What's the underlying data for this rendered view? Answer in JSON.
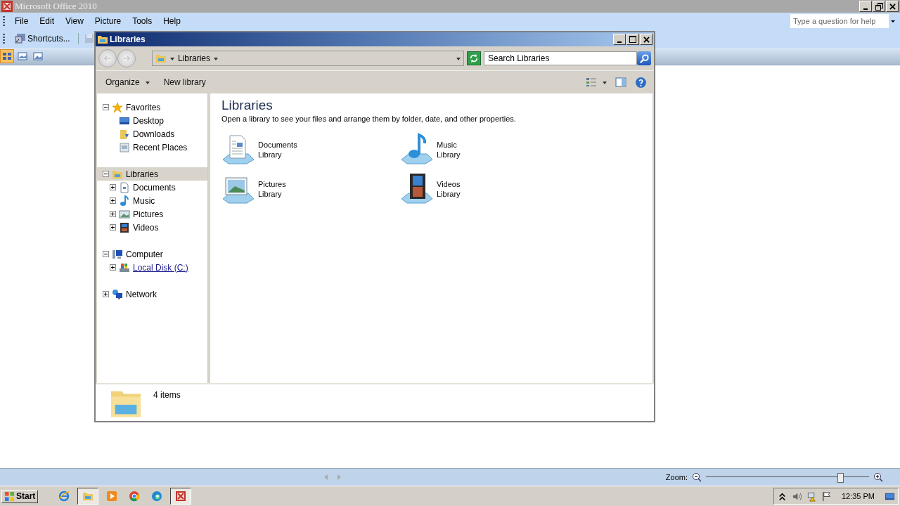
{
  "app": {
    "title": "Microsoft Office 2010",
    "menu": [
      "File",
      "Edit",
      "View",
      "Picture",
      "Tools",
      "Help"
    ],
    "help_box": {
      "placeholder": "Type a question for help"
    },
    "toolbar": {
      "shortcuts": "Shortcuts..."
    },
    "view_buttons": [
      {
        "selected": true
      },
      {
        "selected": false
      },
      {
        "selected": false
      }
    ]
  },
  "explorer": {
    "title": "Libraries",
    "address": "Libraries",
    "search": {
      "placeholder": "Search Libraries"
    },
    "commands": [
      "Organize",
      "New library"
    ],
    "nav_tree": [
      {
        "label": "Favorites",
        "expanded": true,
        "selected": false,
        "link": false,
        "children": [
          {
            "label": "Desktop",
            "selected": false,
            "link": false
          },
          {
            "label": "Downloads",
            "selected": false,
            "link": false
          },
          {
            "label": "Recent Places",
            "selected": false,
            "link": false
          }
        ]
      },
      {
        "label": "Libraries",
        "expanded": true,
        "selected": true,
        "link": false,
        "children": [
          {
            "label": "Documents",
            "expanded": false,
            "selected": false,
            "link": false
          },
          {
            "label": "Music",
            "expanded": false,
            "selected": false,
            "link": false
          },
          {
            "label": "Pictures",
            "expanded": false,
            "selected": false,
            "link": false
          },
          {
            "label": "Videos",
            "expanded": false,
            "selected": false,
            "link": false
          }
        ]
      },
      {
        "label": "Computer",
        "expanded": true,
        "selected": false,
        "link": false,
        "children": [
          {
            "label": "Local Disk (C:)",
            "expanded": false,
            "selected": false,
            "link": true
          }
        ]
      },
      {
        "label": "Network",
        "expanded": false,
        "selected": false,
        "link": false
      }
    ],
    "heading": "Libraries",
    "description": "Open a library to see your files and arrange them by folder, date, and other properties.",
    "libraries": [
      {
        "name": "Documents",
        "type": "Library"
      },
      {
        "name": "Music",
        "type": "Library"
      },
      {
        "name": "Pictures",
        "type": "Library"
      },
      {
        "name": "Videos",
        "type": "Library"
      }
    ],
    "details": "4 items"
  },
  "status_bar": {
    "zoom_label": "Zoom:",
    "zoom": {
      "level": 0.82
    }
  },
  "taskbar": {
    "start": "Start",
    "buttons": [
      {
        "selected": false
      },
      {
        "selected": true
      },
      {
        "selected": false
      },
      {
        "selected": false
      },
      {
        "selected": false
      },
      {
        "selected": true
      }
    ],
    "clock": "12:35 PM"
  }
}
